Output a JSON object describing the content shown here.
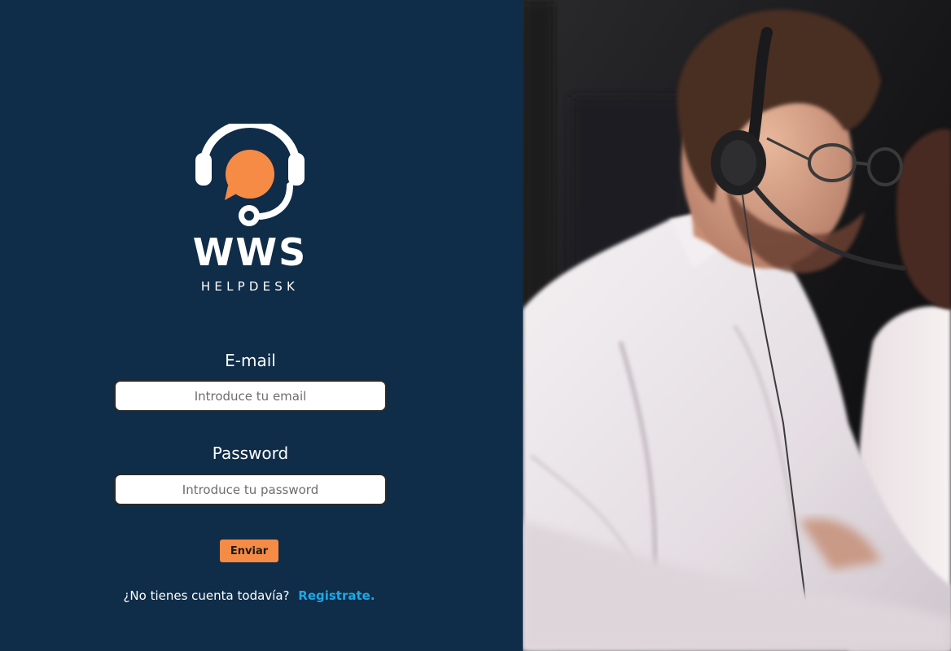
{
  "brand": {
    "name": "WWS",
    "subtitle": "HELPDESK",
    "accent_color": "#f68b46",
    "logo_icon": "headset-chat-icon"
  },
  "form": {
    "email": {
      "label": "E-mail",
      "placeholder": "Introduce tu email",
      "value": ""
    },
    "password": {
      "label": "Password",
      "placeholder": "Introduce tu password",
      "value": ""
    },
    "submit_label": "Enviar"
  },
  "register": {
    "prompt": "¿No tienes cuenta todavía?",
    "link_label": "Registrate.",
    "link_color": "#1ea8e6"
  },
  "colors": {
    "panel_background": "#0f2c48",
    "text": "#ffffff"
  }
}
